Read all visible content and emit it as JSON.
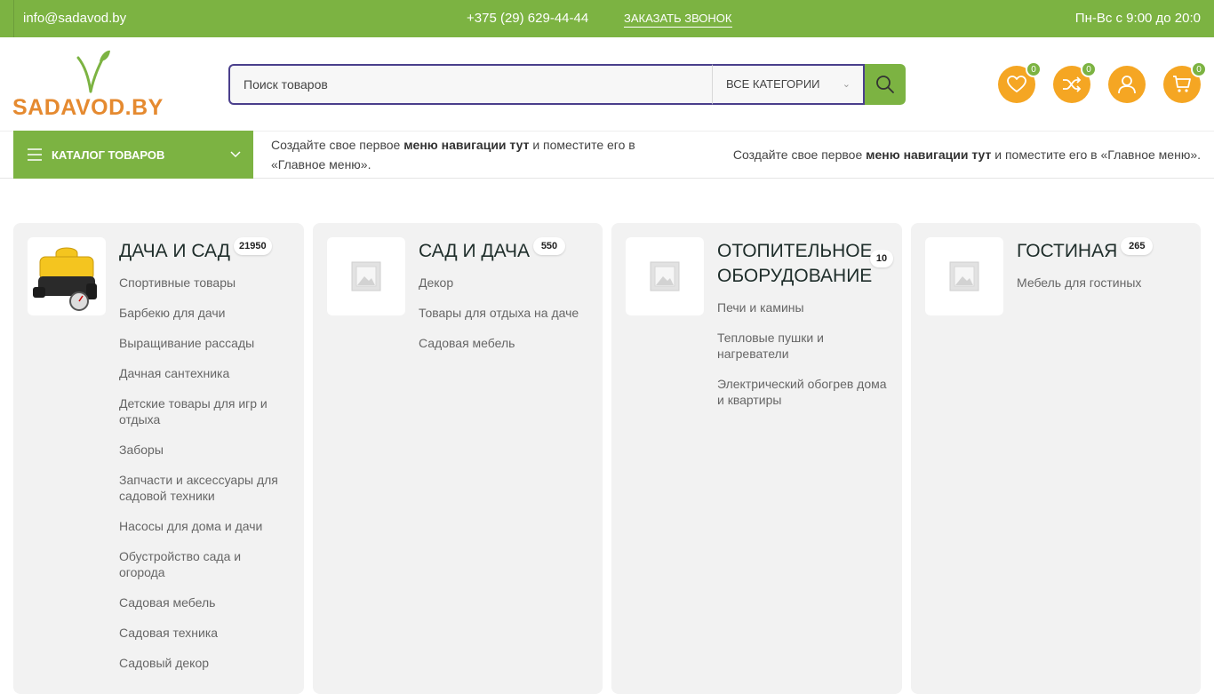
{
  "topbar": {
    "email": "info@sadavod.by",
    "phone": "+375 (29) 629-44-44",
    "callback": "ЗАКАЗАТЬ ЗВОНОК",
    "hours": "Пн-Вс с 9:00 до 20:0"
  },
  "logo": {
    "text": "SADAVOD.BY"
  },
  "search": {
    "placeholder": "Поиск товаров",
    "category": "ВСЕ КАТЕГОРИИ"
  },
  "header_icons": [
    {
      "name": "heart-icon",
      "count": "0"
    },
    {
      "name": "shuffle-icon",
      "count": "0"
    },
    {
      "name": "user-icon"
    },
    {
      "name": "cart-icon",
      "count": "0"
    }
  ],
  "nav": {
    "catalog_label": "КАТАЛОГ ТОВАРОВ",
    "msg_pre": "Создайте свое первое ",
    "msg_bold": "меню навигации тут",
    "msg_post": " и поместите его в «Главное меню»."
  },
  "categories": [
    {
      "title": "ДАЧА И САД",
      "count": "21950",
      "items": [
        "Спортивные товары",
        "Барбекю для дачи",
        "Выращивание рассады",
        "Дачная сантехника",
        "Детские товары для игр и отдыха",
        "Заборы",
        "Запчасти и аксессуары для садовой техники",
        "Насосы для дома и дачи",
        "Обустройство сада и огорода",
        "Садовая мебель",
        "Садовая техника",
        "Садовый декор"
      ]
    },
    {
      "title": "САД И ДАЧА",
      "count": "550",
      "items": [
        "Декор",
        "Товары для отдыха на даче",
        "Садовая мебель"
      ]
    },
    {
      "title": "ОТОПИТЕЛЬНОЕ ОБОРУДОВАНИЕ",
      "count": "10",
      "items": [
        "Печи и камины",
        "Тепловые пушки и нагреватели",
        "Электрический обогрев дома и квартиры"
      ]
    },
    {
      "title": "ГОСТИНАЯ",
      "count": "265",
      "items": [
        "Мебель для гостиных"
      ]
    }
  ],
  "colors": {
    "accent": "#7cb342",
    "orange": "#f5a623",
    "search_border": "#4a3f8c"
  }
}
